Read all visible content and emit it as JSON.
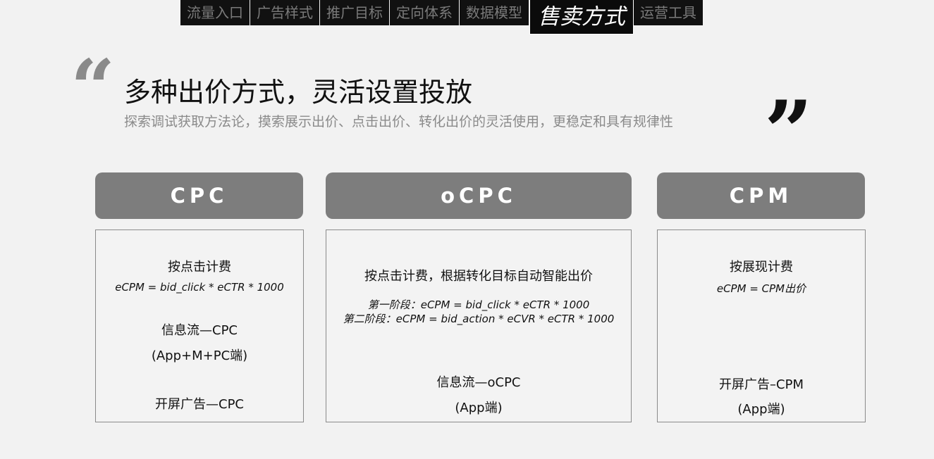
{
  "nav": {
    "items": [
      "流量入口",
      "广告样式",
      "推广目标",
      "定向体系",
      "数据模型",
      "售卖方式",
      "运营工具"
    ],
    "active_index": 5
  },
  "heading": {
    "open_quote": "“",
    "title": "多种出价方式，灵活设置投放",
    "subtitle": "探索调试获取方法论，摸索展示出价、点击出价、转化出价的灵活使用，更稳定和具有规律性",
    "close_quote": "”"
  },
  "columns": [
    {
      "header": "CPC",
      "billing": "按点击计费",
      "formula": "eCPM = bid_click * eCTR * 1000",
      "feed_label": "信息流—CPC",
      "feed_platforms": "(App+M+PC端)",
      "splash_label": "开屏广告—CPC"
    },
    {
      "header": "oCPC",
      "billing": "按点击计费，根据转化目标自动智能出价",
      "stage1": "第一阶段：eCPM = bid_click * eCTR * 1000",
      "stage2": "第二阶段：eCPM = bid_action * eCVR * eCTR * 1000",
      "feed_label": "信息流—oCPC",
      "feed_platforms": "(App端)"
    },
    {
      "header": "CPM",
      "billing": "按展现计费",
      "formula": "eCPM = CPM出价",
      "splash_label": "开屏广告–CPM",
      "splash_platforms": "(App端)"
    }
  ],
  "colors": {
    "background": "#f2f2f2",
    "nav_bg": "#111111",
    "header_bg": "#7d7d7d",
    "muted_text": "#8a8a8a"
  }
}
